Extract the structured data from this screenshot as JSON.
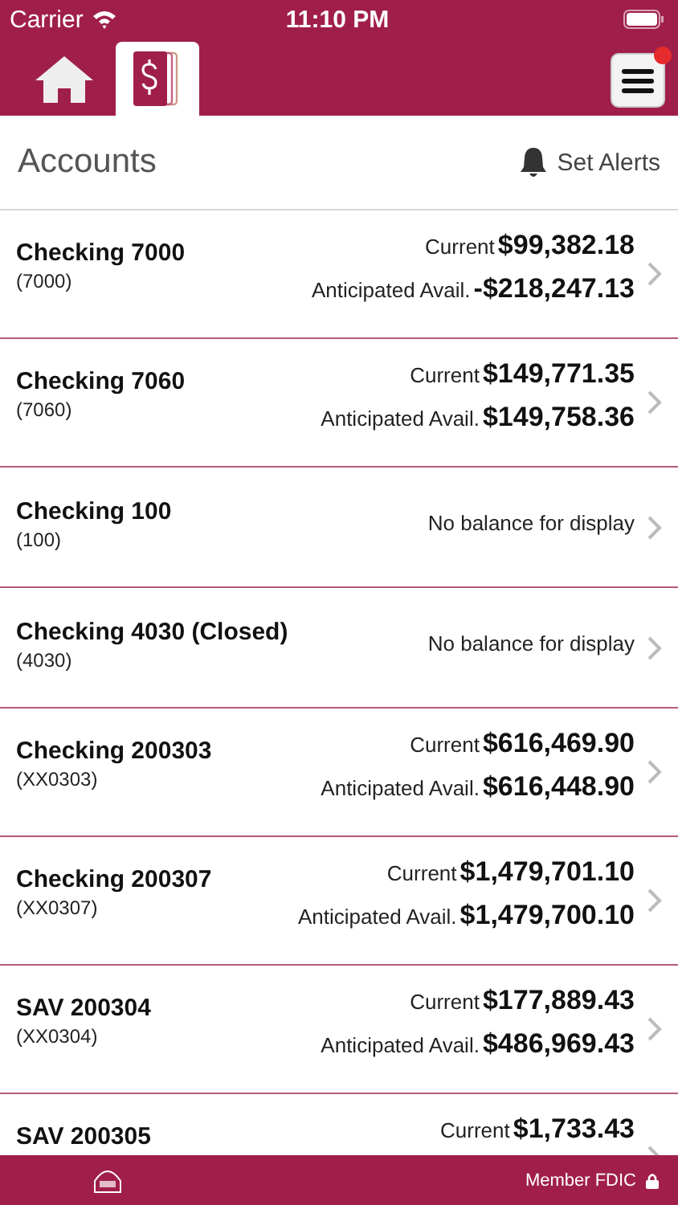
{
  "status_bar": {
    "carrier": "Carrier",
    "time": "11:10 PM"
  },
  "tabs": [
    {
      "kind": "home",
      "selected": false
    },
    {
      "kind": "accounts",
      "selected": true
    }
  ],
  "menu": {
    "notification": true
  },
  "header": {
    "title": "Accounts",
    "alerts": "Set Alerts"
  },
  "accounts": [
    {
      "kind": "balances",
      "name": "Checking 7000",
      "number": "(7000)",
      "current_label": "Current",
      "current": "$99,382.18",
      "anticipated_label": "Anticipated Avail.",
      "anticipated": "-$218,247.13"
    },
    {
      "kind": "balances",
      "name": "Checking 7060",
      "number": "(7060)",
      "current_label": "Current",
      "current": "$149,771.35",
      "anticipated_label": "Anticipated Avail.",
      "anticipated": "$149,758.36"
    },
    {
      "kind": "none",
      "name": "Checking 100",
      "number": "(100)",
      "message": "No balance for display"
    },
    {
      "kind": "none",
      "name": "Checking 4030 (Closed)",
      "number": "(4030)",
      "message": "No balance for display"
    },
    {
      "kind": "balances",
      "name": "Checking 200303",
      "number": "(XX0303)",
      "current_label": "Current",
      "current": "$616,469.90",
      "anticipated_label": "Anticipated Avail.",
      "anticipated": "$616,448.90"
    },
    {
      "kind": "balances",
      "name": "Checking 200307",
      "number": "(XX0307)",
      "current_label": "Current",
      "current": "$1,479,701.10",
      "anticipated_label": "Anticipated Avail.",
      "anticipated": "$1,479,700.10"
    },
    {
      "kind": "balances",
      "name": "SAV 200304",
      "number": "(XX0304)",
      "current_label": "Current",
      "current": "$177,889.43",
      "anticipated_label": "Anticipated Avail.",
      "anticipated": "$486,969.43"
    },
    {
      "kind": "balances",
      "name": "SAV 200305",
      "current_label": "Current",
      "current": "$1,733.43"
    }
  ],
  "footer": {
    "text": "Member FDIC"
  }
}
